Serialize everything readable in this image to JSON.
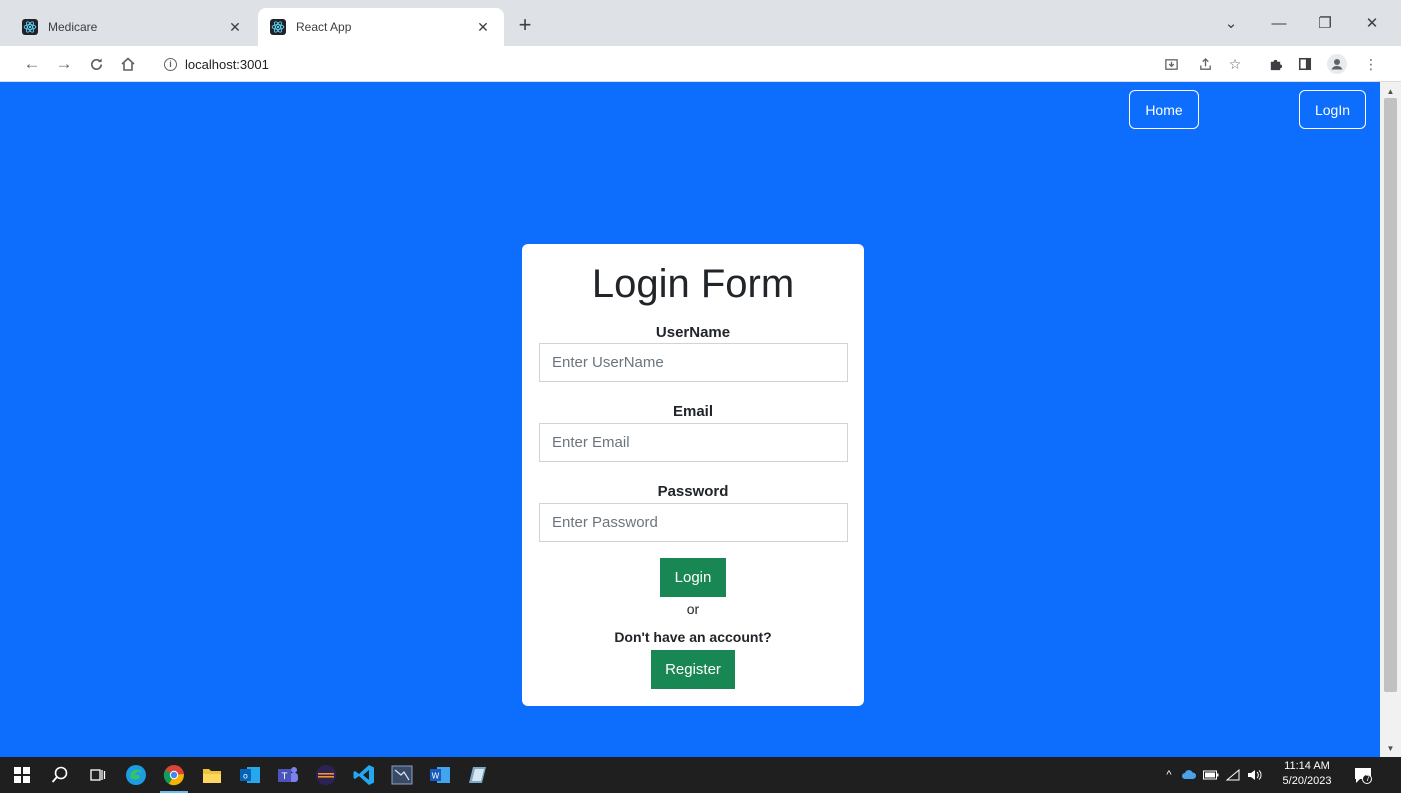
{
  "browser": {
    "tabs": [
      {
        "label": "Medicare",
        "active": false
      },
      {
        "label": "React App",
        "active": true
      }
    ],
    "new_tab_symbol": "+",
    "url": "localhost:3001",
    "window_controls": {
      "dropdown": "⌄",
      "minimize": "—",
      "restore": "❐",
      "close": "✕"
    },
    "tab_close_symbol": "✕"
  },
  "page": {
    "nav": {
      "home_label": "Home",
      "login_label": "LogIn"
    },
    "form": {
      "title": "Login Form",
      "username_label": "UserName",
      "username_placeholder": "Enter UserName",
      "email_label": "Email",
      "email_placeholder": "Enter Email",
      "password_label": "Password",
      "password_placeholder": "Enter Password",
      "login_button": "Login",
      "or_text": "or",
      "no_account_text": "Don't have an account?",
      "register_button": "Register"
    },
    "colors": {
      "background": "#0d6efd",
      "button": "#198754"
    }
  },
  "taskbar": {
    "time": "11:14 AM",
    "date": "5/20/2023",
    "notification_count": "7"
  }
}
